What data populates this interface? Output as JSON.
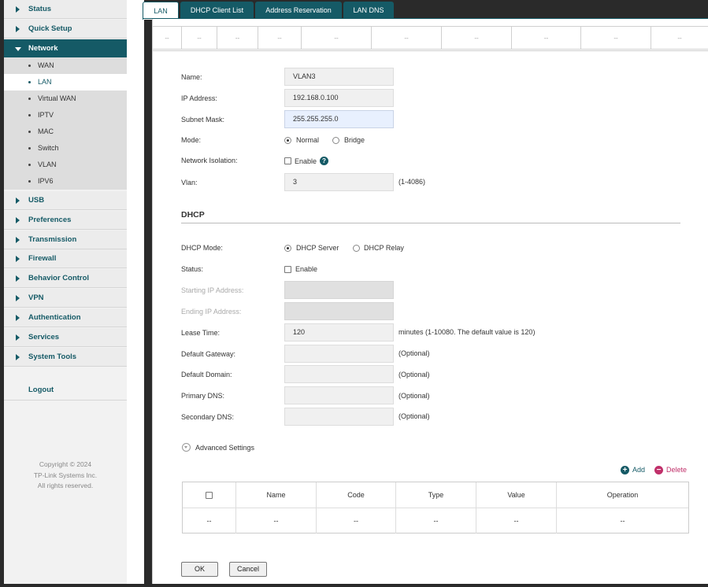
{
  "sidebar": {
    "items": [
      {
        "label": "Status"
      },
      {
        "label": "Quick Setup"
      },
      {
        "label": "Network"
      },
      {
        "label": "USB"
      },
      {
        "label": "Preferences"
      },
      {
        "label": "Transmission"
      },
      {
        "label": "Firewall"
      },
      {
        "label": "Behavior Control"
      },
      {
        "label": "VPN"
      },
      {
        "label": "Authentication"
      },
      {
        "label": "Services"
      },
      {
        "label": "System Tools"
      }
    ],
    "network_sub": [
      {
        "label": "WAN"
      },
      {
        "label": "LAN"
      },
      {
        "label": "Virtual WAN"
      },
      {
        "label": "IPTV"
      },
      {
        "label": "MAC"
      },
      {
        "label": "Switch"
      },
      {
        "label": "VLAN"
      },
      {
        "label": "IPV6"
      }
    ],
    "logout": "Logout",
    "copyright": [
      "Copyright  © 2024",
      "TP-Link Systems Inc.",
      "All rights reserved."
    ]
  },
  "tabs": [
    {
      "label": "LAN"
    },
    {
      "label": "DHCP Client List"
    },
    {
      "label": "Address Reservation"
    },
    {
      "label": "LAN DNS"
    }
  ],
  "top_table": {
    "placeholder": "--"
  },
  "form": {
    "name": {
      "label": "Name:",
      "value": "VLAN3"
    },
    "ip": {
      "label": "IP Address:",
      "value": "192.168.0.100"
    },
    "mask": {
      "label": "Subnet Mask:",
      "value": "255.255.255.0"
    },
    "mode": {
      "label": "Mode:",
      "options": [
        "Normal",
        "Bridge"
      ],
      "selected": "Normal"
    },
    "isolation": {
      "label": "Network Isolation:",
      "option": "Enable",
      "checked": false
    },
    "vlan": {
      "label": "Vlan:",
      "value": "3",
      "hint": "(1-4086)"
    }
  },
  "dhcp": {
    "title": "DHCP",
    "mode": {
      "label": "DHCP Mode:",
      "options": [
        "DHCP Server",
        "DHCP Relay"
      ],
      "selected": "DHCP Server"
    },
    "status": {
      "label": "Status:",
      "option": "Enable",
      "checked": false
    },
    "start_ip": {
      "label": "Starting IP Address:",
      "value": ""
    },
    "end_ip": {
      "label": "Ending IP Address:",
      "value": ""
    },
    "lease": {
      "label": "Lease Time:",
      "value": "120",
      "hint": "minutes (1-10080. The default value is 120)"
    },
    "gateway": {
      "label": "Default Gateway:",
      "value": "",
      "hint": "(Optional)"
    },
    "domain": {
      "label": "Default Domain:",
      "value": "",
      "hint": "(Optional)"
    },
    "dns1": {
      "label": "Primary DNS:",
      "value": "",
      "hint": "(Optional)"
    },
    "dns2": {
      "label": "Secondary DNS:",
      "value": "",
      "hint": "(Optional)"
    }
  },
  "advanced": {
    "label": "Advanced Settings"
  },
  "options_table": {
    "add_label": "Add",
    "delete_label": "Delete",
    "headers": [
      "Name",
      "Code",
      "Type",
      "Value",
      "Operation"
    ],
    "row": [
      "--",
      "--",
      "--",
      "--",
      "--",
      "--"
    ]
  },
  "buttons": {
    "ok": "OK",
    "cancel": "Cancel"
  },
  "colors": {
    "accent": "#155a66",
    "delete": "#c0306a"
  }
}
